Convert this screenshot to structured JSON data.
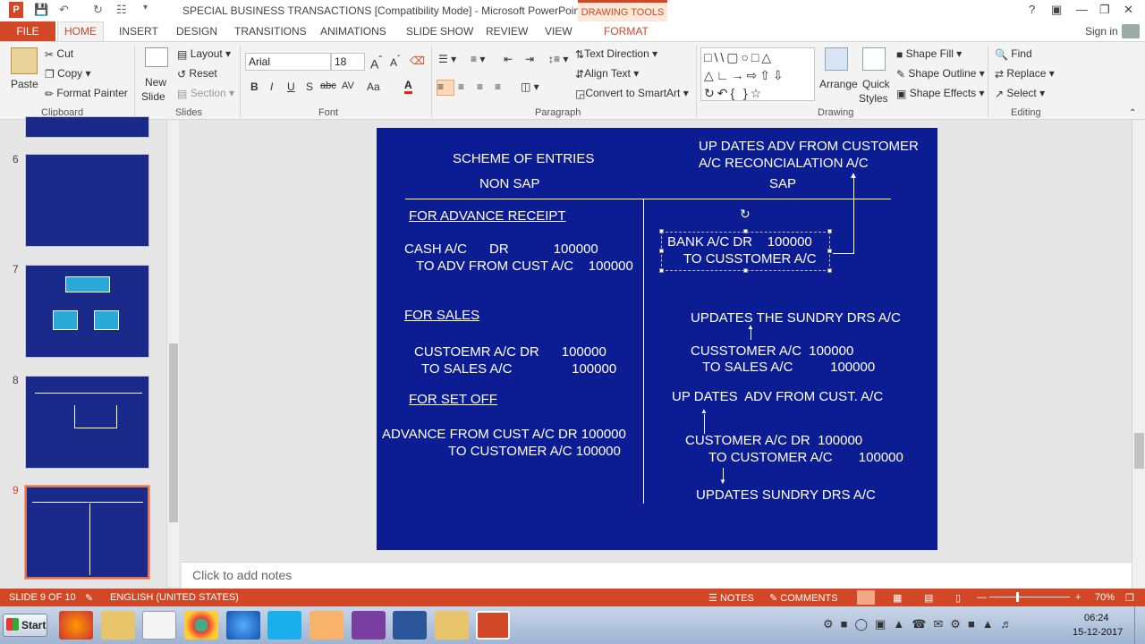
{
  "window": {
    "title": "SPECIAL BUSINESS TRANSACTIONS [Compatibility Mode] - Microsoft PowerPoint",
    "context_group": "DRAWING TOOLS",
    "signin": "Sign in",
    "help": "?"
  },
  "tabs": [
    "FILE",
    "HOME",
    "INSERT",
    "DESIGN",
    "TRANSITIONS",
    "ANIMATIONS",
    "SLIDE SHOW",
    "REVIEW",
    "VIEW",
    "FORMAT"
  ],
  "ribbon": {
    "clipboard": {
      "label": "Clipboard",
      "paste": "Paste",
      "cut": "Cut",
      "copy": "Copy",
      "format_painter": "Format Painter"
    },
    "slides": {
      "label": "Slides",
      "new_slide_1": "New",
      "new_slide_2": "Slide",
      "layout": "Layout",
      "reset": "Reset",
      "section": "Section"
    },
    "font": {
      "label": "Font",
      "name": "Arial",
      "size": "18",
      "bold": "B",
      "italic": "I",
      "underline": "U",
      "shadow": "S",
      "strike": "abc",
      "spacing": "AV",
      "case": "Aa",
      "color": "A"
    },
    "paragraph": {
      "label": "Paragraph",
      "text_direction": "Text Direction",
      "align_text": "Align Text",
      "convert_smartart": "Convert to SmartArt"
    },
    "drawing": {
      "label": "Drawing",
      "arrange": "Arrange",
      "quick_styles_1": "Quick",
      "quick_styles_2": "Styles",
      "shape_fill": "Shape Fill",
      "shape_outline": "Shape Outline",
      "shape_effects": "Shape Effects"
    },
    "editing": {
      "label": "Editing",
      "find": "Find",
      "replace": "Replace",
      "select": "Select"
    }
  },
  "thumbnails": [
    {
      "num": "6"
    },
    {
      "num": "7"
    },
    {
      "num": "8"
    },
    {
      "num": "9"
    }
  ],
  "slide": {
    "scheme": "SCHEME OF ENTRIES",
    "non_sap": "NON SAP",
    "sap": "SAP",
    "sap_note_1": "UP DATES ADV FROM CUSTOMER",
    "sap_note_2": "A/C RECONCIALATION A/C",
    "adv_head": "FOR ADVANCE RECEIPT",
    "adv_l1": "CASH A/C      DR            100000",
    "adv_l2": "TO ADV FROM CUST A/C    100000",
    "bank_l1": "BANK A/C DR    100000",
    "bank_l2": "TO CUSSTOMER A/C",
    "sales_head": "FOR SALES",
    "sales_l1": "CUSTOEMR A/C DR      100000",
    "sales_l2": "TO SALES A/C                100000",
    "upd_sundry": "UPDATES THE SUNDRY DRS A/C",
    "cust_l1": "CUSSTOMER A/C  100000",
    "cust_l2": "TO SALES A/C          100000",
    "setoff_head": "FOR SET OFF",
    "upd_adv": "UP DATES  ADV FROM CUST. A/C",
    "setoff_l1": "ADVANCE FROM CUST A/C DR 100000",
    "setoff_l2": "TO CUSTOMER A/C 100000",
    "sap_set_l1": "CUSTOMER A/C DR  100000",
    "sap_set_l2": "TO CUSTOMER A/C       100000",
    "upd_sundry2": "UPDATES SUNDRY DRS A/C"
  },
  "notes_placeholder": "Click to add notes",
  "status": {
    "slide": "SLIDE 9 OF 10",
    "language": "ENGLISH (UNITED STATES)",
    "notes": "NOTES",
    "comments": "COMMENTS",
    "zoom": "70%"
  },
  "taskbar": {
    "start": "Start",
    "time": "06:24",
    "date": "15-12-2017"
  },
  "colors": {
    "accent": "#d24726",
    "slide_bg": "#0c1d94"
  }
}
